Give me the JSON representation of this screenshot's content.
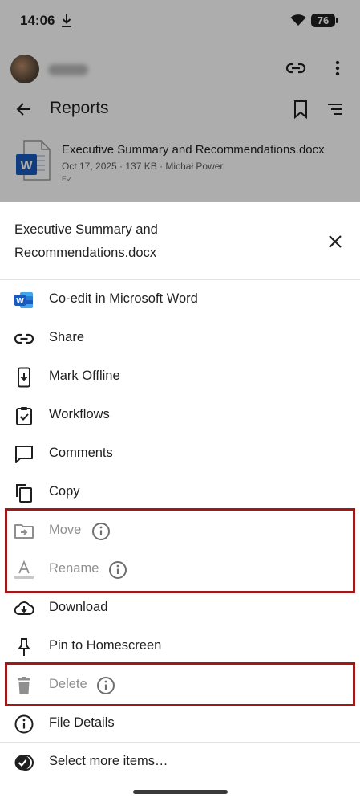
{
  "status_bar": {
    "time": "14:06",
    "battery": "76"
  },
  "background": {
    "page_title": "Reports",
    "file": {
      "name": "Executive Summary and Recommendations.docx",
      "meta": "Oct 17, 2025 · 137 KB · Michał Power",
      "sub": "Е✓"
    }
  },
  "sheet": {
    "title": "Executive Summary and Recommendations.docx",
    "items": [
      {
        "label": "Co-edit in Microsoft Word",
        "icon": "word-icon",
        "enabled": true
      },
      {
        "label": "Share",
        "icon": "link-icon",
        "enabled": true
      },
      {
        "label": "Mark Offline",
        "icon": "offline-download-icon",
        "enabled": true
      },
      {
        "label": "Workflows",
        "icon": "clipboard-check-icon",
        "enabled": true
      },
      {
        "label": "Comments",
        "icon": "comment-icon",
        "enabled": true
      },
      {
        "label": "Copy",
        "icon": "copy-icon",
        "enabled": true
      },
      {
        "label": "Move",
        "icon": "move-folder-icon",
        "enabled": false
      },
      {
        "label": "Rename",
        "icon": "rename-icon",
        "enabled": false
      },
      {
        "label": "Download",
        "icon": "cloud-download-icon",
        "enabled": true
      },
      {
        "label": "Pin to Homescreen",
        "icon": "pin-icon",
        "enabled": true
      },
      {
        "label": "Delete",
        "icon": "trash-icon",
        "enabled": false
      },
      {
        "label": "File Details",
        "icon": "info-icon",
        "enabled": true
      },
      {
        "label": "Select more items…",
        "icon": "select-multiple-icon",
        "enabled": true
      }
    ]
  },
  "colors": {
    "highlight": "#9e1a1a",
    "disabled_text": "#8f8f8f",
    "word_blue": "#185abd"
  }
}
